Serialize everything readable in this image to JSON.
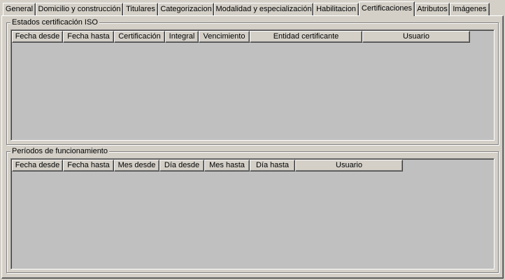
{
  "tabs": [
    {
      "label": "General",
      "active": false
    },
    {
      "label": "Domicilio y construcción",
      "active": false
    },
    {
      "label": "Titulares",
      "active": false
    },
    {
      "label": "Categorizacion",
      "active": false
    },
    {
      "label": "Modalidad y especialización",
      "active": false
    },
    {
      "label": "Habilitacion",
      "active": false
    },
    {
      "label": "Certificaciones",
      "active": true
    },
    {
      "label": "Atributos",
      "active": false
    },
    {
      "label": "Imágenes",
      "active": false
    }
  ],
  "iso_group": {
    "title": "Estados certificación ISO",
    "columns": [
      "Fecha desde",
      "Fecha hasta",
      "Certificación",
      "Integral",
      "Vencimiento",
      "Entidad certificante",
      "Usuario"
    ],
    "rows": []
  },
  "periods_group": {
    "title": "Períodos de funcionamiento",
    "columns": [
      "Fecha desde",
      "Fecha hasta",
      "Mes desde",
      "Día desde",
      "Mes hasta",
      "Día hasta",
      "Usuario"
    ],
    "rows": []
  }
}
